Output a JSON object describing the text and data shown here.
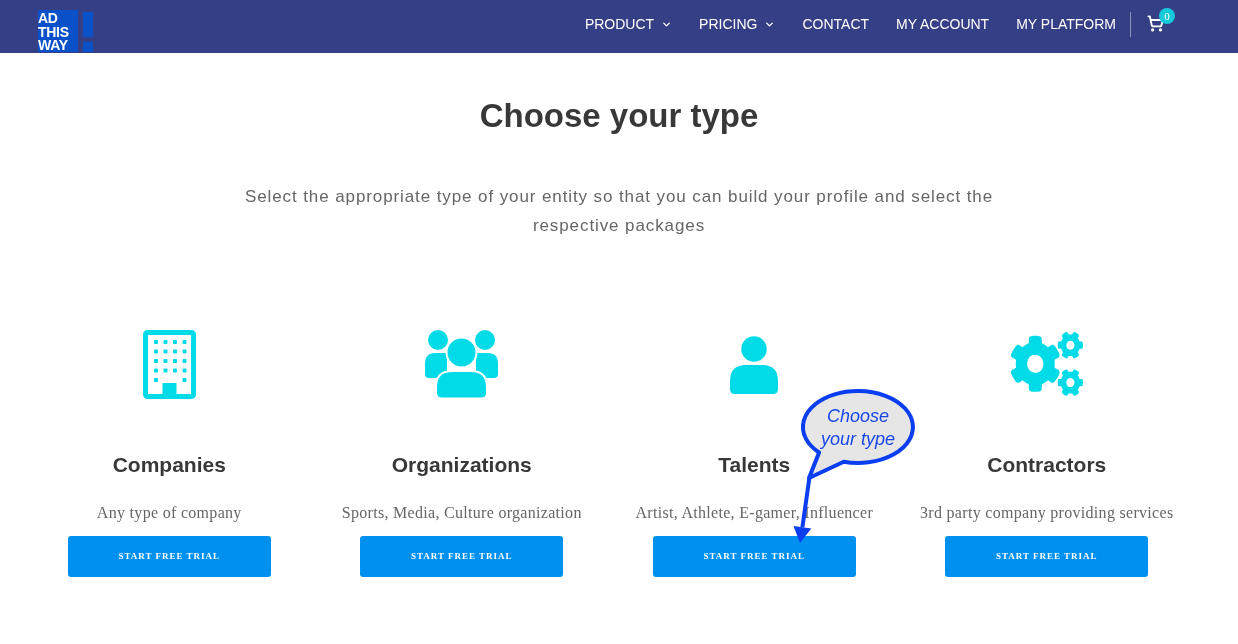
{
  "header": {
    "logo": {
      "text": "AD THIS WAY"
    },
    "nav": [
      {
        "label": "PRODUCT",
        "has_menu": true
      },
      {
        "label": "PRICING",
        "has_menu": true
      },
      {
        "label": "CONTACT",
        "has_menu": false
      },
      {
        "label": "MY ACCOUNT",
        "has_menu": false
      },
      {
        "label": "MY PLATFORM",
        "has_menu": false
      }
    ],
    "cart": {
      "count": "0"
    }
  },
  "hero": {
    "title": "Choose your type",
    "subtitle": "Select the appropriate type of your entity so that you can build your profile and select the respective packages"
  },
  "types": [
    {
      "kind": "building",
      "name": "Companies",
      "description": "Any type of company",
      "button": "START FREE TRIAL"
    },
    {
      "kind": "group",
      "name": "Organizations",
      "description": "Sports, Media, Culture organization",
      "button": "START FREE TRIAL"
    },
    {
      "kind": "person",
      "name": "Talents",
      "description": "Artist, Athlete, E-gamer, Influencer",
      "button": "START FREE TRIAL"
    },
    {
      "kind": "gears",
      "name": "Contractors",
      "description": "3rd party company providing services",
      "button": "START FREE TRIAL"
    }
  ],
  "callout": {
    "text": "Choose your type"
  }
}
